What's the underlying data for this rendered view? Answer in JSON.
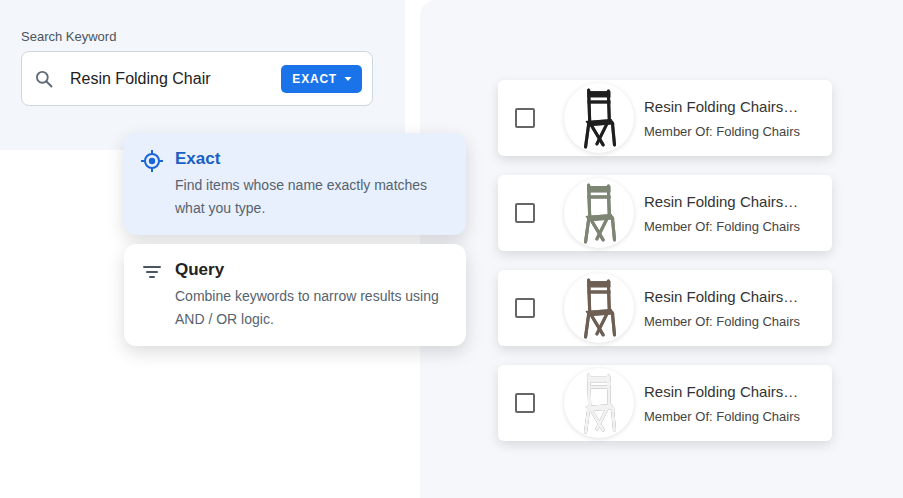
{
  "search": {
    "label": "Search Keyword",
    "value": "Resin Folding Chair",
    "mode": "EXACT"
  },
  "match_options": [
    {
      "title": "Exact",
      "description": "Find items whose name exactly matches what you type.",
      "selected": true,
      "kind": "exact"
    },
    {
      "title": "Query",
      "description": "Combine keywords to narrow results using AND / OR logic.",
      "selected": false,
      "kind": "query"
    }
  ],
  "products": [
    {
      "name": "Resin Folding Chairs…",
      "member_of": "Member Of: Folding Chairs",
      "checked": false,
      "color": "#1e1e1e"
    },
    {
      "name": "Resin Folding Chairs…",
      "member_of": "Member Of: Folding Chairs",
      "checked": false,
      "color": "#7d8672"
    },
    {
      "name": "Resin Folding Chairs…",
      "member_of": "Member Of: Folding Chairs",
      "checked": false,
      "color": "#6e5f52"
    },
    {
      "name": "Resin Folding Chairs…",
      "member_of": "Member Of: Folding Chairs",
      "checked": false,
      "color": "#f2f2f2"
    }
  ]
}
